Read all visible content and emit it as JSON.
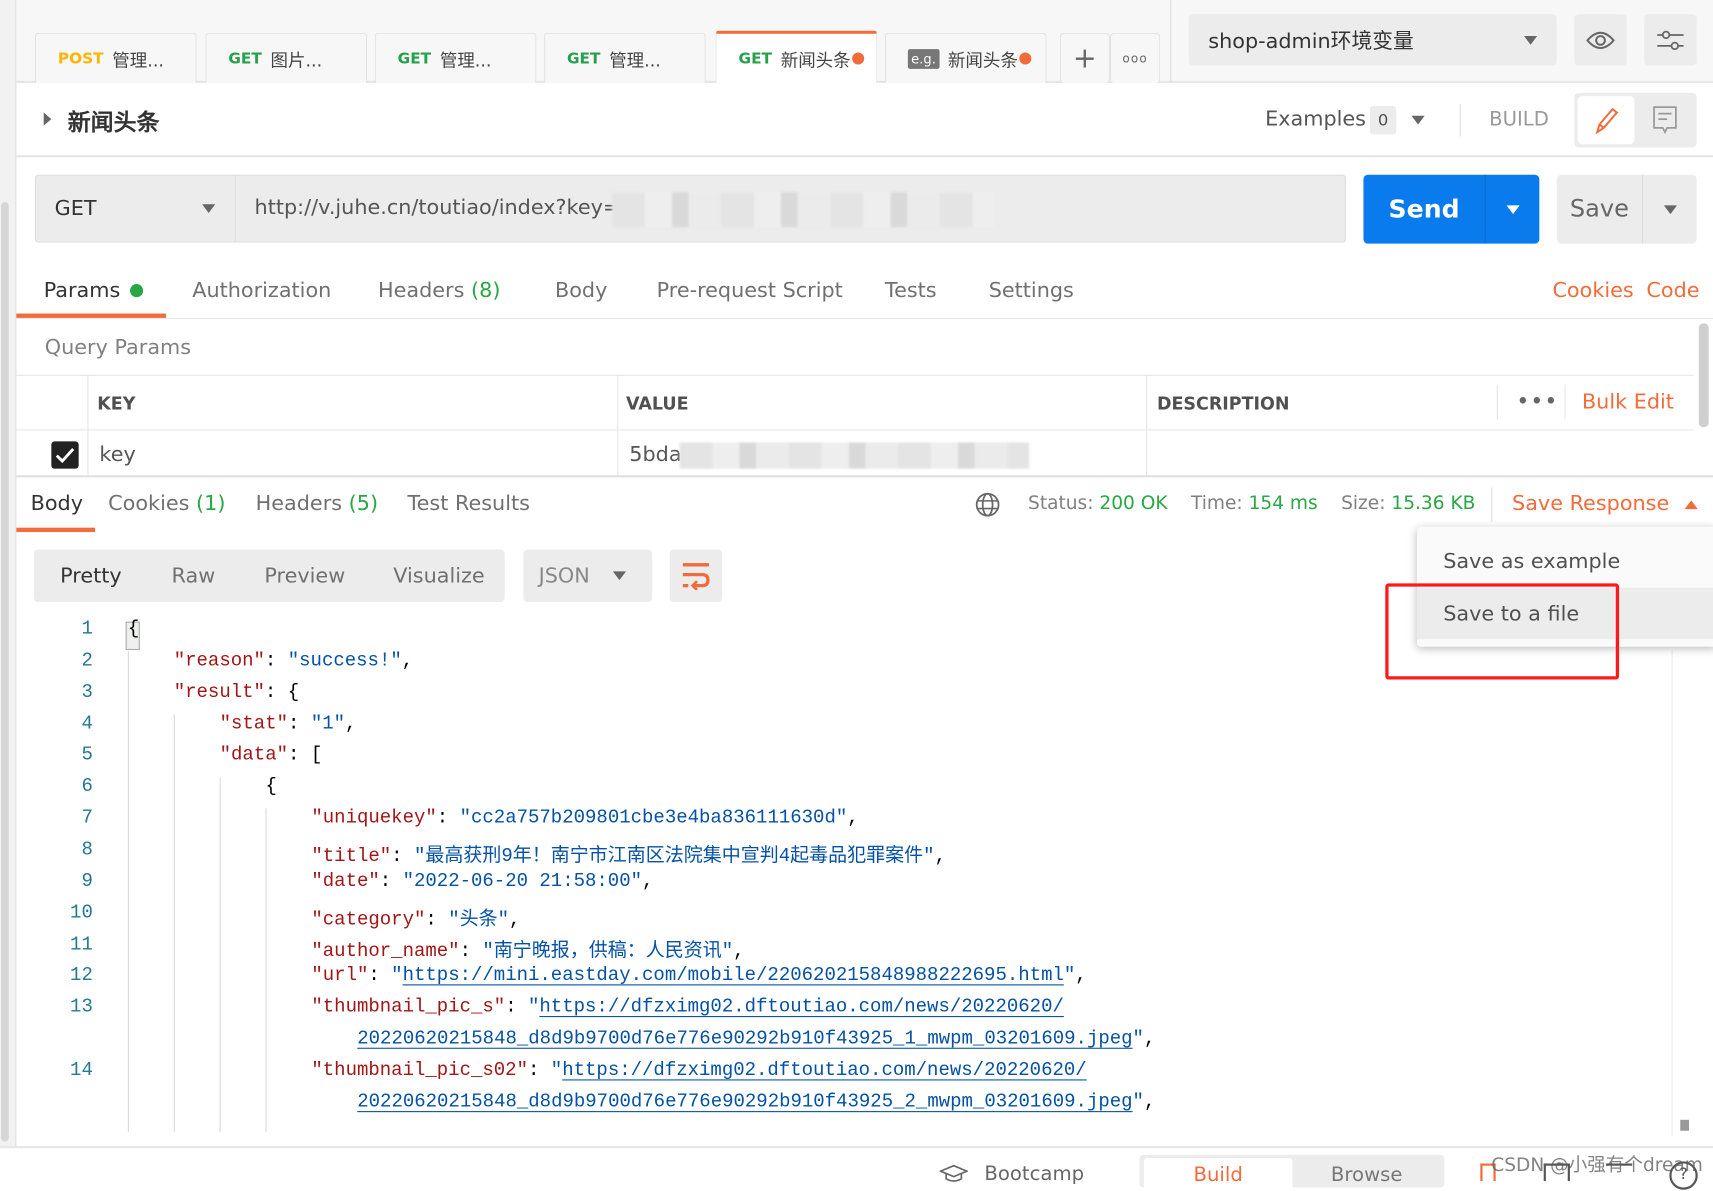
{
  "tabs": [
    {
      "method": "POST",
      "label": "管理...",
      "method_color": "#ffb400"
    },
    {
      "method": "GET",
      "label": "图片...",
      "method_color": "#26a04a"
    },
    {
      "method": "GET",
      "label": "管理...",
      "method_color": "#26a04a"
    },
    {
      "method": "GET",
      "label": "管理...",
      "method_color": "#26a04a"
    },
    {
      "method": "GET",
      "label": "新闻头条",
      "method_color": "#26a04a",
      "active": true,
      "unsaved": true
    },
    {
      "method": "e.g.",
      "label": "新闻头条",
      "unsaved": true
    }
  ],
  "environment": {
    "selected": "shop-admin环境变量"
  },
  "request": {
    "name": "新闻头条",
    "examples_label": "Examples",
    "examples_count": "0",
    "build_label": "BUILD",
    "method": "GET",
    "url": "http://v.juhe.cn/toutiao/index?key=5",
    "send_label": "Send",
    "save_label": "Save"
  },
  "request_tabs": {
    "params": "Params",
    "authorization": "Authorization",
    "headers": "Headers",
    "headers_count": "(8)",
    "body": "Body",
    "prerequest": "Pre-request Script",
    "tests": "Tests",
    "settings": "Settings",
    "cookies": "Cookies",
    "code": "Code"
  },
  "query_params": {
    "title": "Query Params",
    "columns": [
      "KEY",
      "VALUE",
      "DESCRIPTION"
    ],
    "bulk_edit": "Bulk Edit",
    "rows": [
      {
        "checked": true,
        "key": "key",
        "value": "5bda",
        "description": ""
      }
    ]
  },
  "response": {
    "tabs": {
      "body": "Body",
      "cookies": "Cookies",
      "cookies_count": "(1)",
      "headers": "Headers",
      "headers_count": "(5)",
      "test_results": "Test Results"
    },
    "status_label": "Status:",
    "status": "200 OK",
    "time_label": "Time:",
    "time": "154 ms",
    "size_label": "Size:",
    "size": "15.36 KB",
    "save_response": "Save Response",
    "menu": [
      "Save as example",
      "Save to a file"
    ],
    "views": [
      "Pretty",
      "Raw",
      "Preview",
      "Visualize"
    ],
    "format": "JSON"
  },
  "code_lines": [
    {
      "n": "1",
      "indent": 0,
      "parts": [
        [
          "p",
          "{"
        ]
      ]
    },
    {
      "n": "2",
      "indent": 1,
      "parts": [
        [
          "k",
          "\"reason\""
        ],
        [
          "p",
          ": "
        ],
        [
          "s",
          "\"success!\""
        ],
        [
          "p",
          ","
        ]
      ]
    },
    {
      "n": "3",
      "indent": 1,
      "parts": [
        [
          "k",
          "\"result\""
        ],
        [
          "p",
          ": {"
        ]
      ]
    },
    {
      "n": "4",
      "indent": 2,
      "parts": [
        [
          "k",
          "\"stat\""
        ],
        [
          "p",
          ": "
        ],
        [
          "s",
          "\"1\""
        ],
        [
          "p",
          ","
        ]
      ]
    },
    {
      "n": "5",
      "indent": 2,
      "parts": [
        [
          "k",
          "\"data\""
        ],
        [
          "p",
          ": ["
        ]
      ]
    },
    {
      "n": "6",
      "indent": 3,
      "parts": [
        [
          "p",
          "{"
        ]
      ]
    },
    {
      "n": "7",
      "indent": 4,
      "parts": [
        [
          "k",
          "\"uniquekey\""
        ],
        [
          "p",
          ": "
        ],
        [
          "s",
          "\"cc2a757b209801cbe3e4ba836111630d\""
        ],
        [
          "p",
          ","
        ]
      ]
    },
    {
      "n": "8",
      "indent": 4,
      "parts": [
        [
          "k",
          "\"title\""
        ],
        [
          "p",
          ": "
        ],
        [
          "s",
          "\"最高获刑9年！南宁市江南区法院集中宣判4起毒品犯罪案件\""
        ],
        [
          "p",
          ","
        ]
      ]
    },
    {
      "n": "9",
      "indent": 4,
      "parts": [
        [
          "k",
          "\"date\""
        ],
        [
          "p",
          ": "
        ],
        [
          "s",
          "\"2022-06-20 21:58:00\""
        ],
        [
          "p",
          ","
        ]
      ]
    },
    {
      "n": "10",
      "indent": 4,
      "parts": [
        [
          "k",
          "\"category\""
        ],
        [
          "p",
          ": "
        ],
        [
          "s",
          "\"头条\""
        ],
        [
          "p",
          ","
        ]
      ]
    },
    {
      "n": "11",
      "indent": 4,
      "parts": [
        [
          "k",
          "\"author_name\""
        ],
        [
          "p",
          ": "
        ],
        [
          "s",
          "\"南宁晚报，供稿：人民资讯\""
        ],
        [
          "p",
          ","
        ]
      ]
    },
    {
      "n": "12",
      "indent": 4,
      "parts": [
        [
          "k",
          "\"url\""
        ],
        [
          "p",
          ": "
        ],
        [
          "s",
          "\""
        ],
        [
          "u",
          "https://mini.eastday.com/mobile/220620215848988222695.html"
        ],
        [
          "s",
          "\""
        ],
        [
          "p",
          ","
        ]
      ]
    },
    {
      "n": "13",
      "indent": 4,
      "parts": [
        [
          "k",
          "\"thumbnail_pic_s\""
        ],
        [
          "p",
          ": "
        ],
        [
          "s",
          "\""
        ],
        [
          "u",
          "https://dfzximg02.dftoutiao.com/news/20220620/"
        ]
      ]
    },
    {
      "n": "",
      "indent": 5,
      "parts": [
        [
          "u",
          "20220620215848_d8d9b9700d76e776e90292b910f43925_1_mwpm_03201609.jpeg"
        ],
        [
          "s",
          "\""
        ],
        [
          "p",
          ","
        ]
      ]
    },
    {
      "n": "14",
      "indent": 4,
      "parts": [
        [
          "k",
          "\"thumbnail_pic_s02\""
        ],
        [
          "p",
          ": "
        ],
        [
          "s",
          "\""
        ],
        [
          "u",
          "https://dfzximg02.dftoutiao.com/news/20220620/"
        ]
      ]
    },
    {
      "n": "",
      "indent": 5,
      "parts": [
        [
          "u",
          "20220620215848_d8d9b9700d76e776e90292b910f43925_2_mwpm_03201609.jpeg"
        ],
        [
          "s",
          "\""
        ],
        [
          "p",
          ","
        ]
      ]
    }
  ],
  "footer": {
    "bootcamp": "Bootcamp",
    "build": "Build",
    "browse": "Browse",
    "watermark": "CSDN @小强有个dream"
  },
  "colors": {
    "accent": "#f26b3a",
    "send": "#097bed",
    "success": "#28a745",
    "highlight": "#ff1a1a"
  }
}
